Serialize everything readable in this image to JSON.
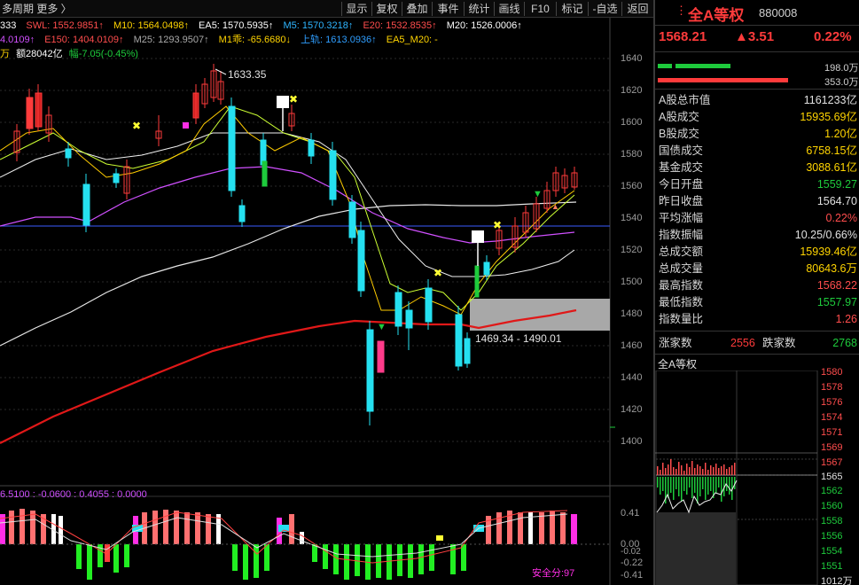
{
  "toolbar": {
    "left_text": "多周期  更多 〉",
    "buttons": [
      "显示",
      "复权",
      "叠加",
      "事件",
      "统计",
      "画线",
      "F10",
      "标记",
      "-自选",
      "返回"
    ]
  },
  "indicators": {
    "line1": [
      {
        "text": "333",
        "color": "#ffffff"
      },
      {
        "text": "SWL: 1552.9851↑",
        "color": "#ff4d4d"
      },
      {
        "text": "M10: 1564.0498↑",
        "color": "#ffd400"
      },
      {
        "text": "EA5: 1570.5935↑",
        "color": "#ffffff"
      },
      {
        "text": "M5: 1570.3218↑",
        "color": "#2fb5ff"
      },
      {
        "text": "E20: 1532.8535↑",
        "color": "#ff4d4d"
      },
      {
        "text": "M20: 1526.0006↑",
        "color": "#ffffff"
      }
    ],
    "line2": [
      {
        "text": "4.0109↑",
        "color": "#d050ff"
      },
      {
        "text": "E150: 1404.0109↑",
        "color": "#ff4d4d"
      },
      {
        "text": "M25: 1293.9507↑",
        "color": "#aaaaaa"
      },
      {
        "text": "M1乖: -65.6680↓",
        "color": "#ffd400"
      },
      {
        "text": "上轨: 1613.0936↑",
        "color": "#2f9eff"
      },
      {
        "text": "EA5_M20: -",
        "color": "#ffd400"
      }
    ],
    "line3": [
      {
        "text": "万",
        "color": "#ffd400"
      },
      {
        "text": "额28042亿",
        "color": "#ffffff"
      },
      {
        "text": "幅-7.05(-0.45%)",
        "color": "#1ecb3c"
      }
    ]
  },
  "chart_annotations": {
    "high_label": "1633.35",
    "range_label": "1469.34 - 1490.01"
  },
  "price_axis": [
    "1640",
    "1620",
    "1600",
    "1580",
    "1560",
    "1540",
    "1520",
    "1500",
    "1480",
    "1460",
    "1440",
    "1420",
    "1400"
  ],
  "macd": {
    "header": "6.5100 : -0.0600 : 0.4055 : 0.0000",
    "axis": [
      "0.41",
      "0.00",
      "-0.02",
      "-0.22",
      "-0.41"
    ],
    "safety_score": "安全分:97"
  },
  "quote": {
    "name": "全A等权",
    "code": "880008",
    "price": "1568.21",
    "change": "▲3.51",
    "change_pct": "0.22%",
    "bar1_value": "198.0万",
    "bar2_value": "353.0万"
  },
  "stats": [
    {
      "label": "A股总市值",
      "value": "1161233亿",
      "color": "#e0e0e0"
    },
    {
      "label": "A股成交",
      "value": "15935.69亿",
      "color": "#ffd400"
    },
    {
      "label": "B股成交",
      "value": "1.20亿",
      "color": "#ffd400"
    },
    {
      "label": "国债成交",
      "value": "6758.15亿",
      "color": "#ffd400"
    },
    {
      "label": "基金成交",
      "value": "3088.61亿",
      "color": "#ffd400"
    },
    {
      "label": "今日开盘",
      "value": "1559.27",
      "color": "#1ecb3c"
    },
    {
      "label": "昨日收盘",
      "value": "1564.70",
      "color": "#e0e0e0"
    },
    {
      "label": "平均涨幅",
      "value": "0.22%",
      "color": "#ff4d4d"
    },
    {
      "label": "指数振幅",
      "value": "10.25/0.66%",
      "color": "#e0e0e0"
    },
    {
      "label": "总成交额",
      "value": "15939.46亿",
      "color": "#ffd400"
    },
    {
      "label": "总成交量",
      "value": "80643.6万",
      "color": "#ffd400"
    },
    {
      "label": "最高指数",
      "value": "1568.22",
      "color": "#ff4d4d"
    },
    {
      "label": "最低指数",
      "value": "1557.97",
      "color": "#1ecb3c"
    },
    {
      "label": "指数量比",
      "value": "1.26",
      "color": "#ff4d4d"
    }
  ],
  "breadth": {
    "up_label": "涨家数",
    "up_value": "2556",
    "down_label": "跌家数",
    "down_value": "2768"
  },
  "mini_chart": {
    "title": "全A等权",
    "ticks_up": [
      "1580",
      "1578",
      "1576",
      "1574",
      "1571",
      "1569",
      "1567"
    ],
    "tick_mid": "1565",
    "ticks_down": [
      "1562",
      "1560",
      "1558",
      "1556",
      "1554",
      "1551"
    ],
    "volume_label": "1012万"
  },
  "colors": {
    "up": "#ff3b3b",
    "down": "#25e0f0",
    "ma_red": "#e01818",
    "green": "#1ecb3c",
    "yellow": "#ffd400"
  }
}
